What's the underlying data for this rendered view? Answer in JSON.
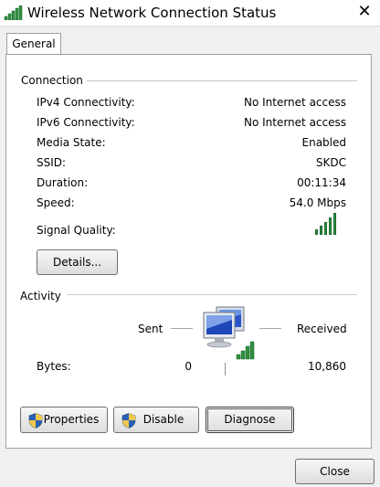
{
  "window": {
    "title": "Wireless Network Connection Status",
    "close_glyph": "✕"
  },
  "tabs": [
    {
      "label": "General"
    }
  ],
  "connection": {
    "heading": "Connection",
    "rows": [
      {
        "label": "IPv4 Connectivity:",
        "value": "No Internet access"
      },
      {
        "label": "IPv6 Connectivity:",
        "value": "No Internet access"
      },
      {
        "label": "Media State:",
        "value": "Enabled"
      },
      {
        "label": "SSID:",
        "value": "SKDC"
      },
      {
        "label": "Duration:",
        "value": "00:11:34"
      },
      {
        "label": "Speed:",
        "value": "54.0 Mbps"
      }
    ],
    "signal_label": "Signal Quality:",
    "signal_bars_lit": 5,
    "signal_bars_total": 5,
    "details_button": "Details..."
  },
  "activity": {
    "heading": "Activity",
    "sent_label": "Sent",
    "received_label": "Received",
    "bytes_label": "Bytes:",
    "bytes_sent": "0",
    "bytes_received": "10,860"
  },
  "actions": {
    "properties": "Properties",
    "disable": "Disable",
    "diagnose": "Diagnose"
  },
  "footer": {
    "close": "Close"
  },
  "colors": {
    "signal_green": "#2f8f3f",
    "shield_blue": "#2b5fb4",
    "shield_yellow": "#f2c94c"
  },
  "icons": {
    "title": "wifi-signal-icon",
    "network": "network-computers-icon",
    "shield": "uac-shield-icon"
  }
}
